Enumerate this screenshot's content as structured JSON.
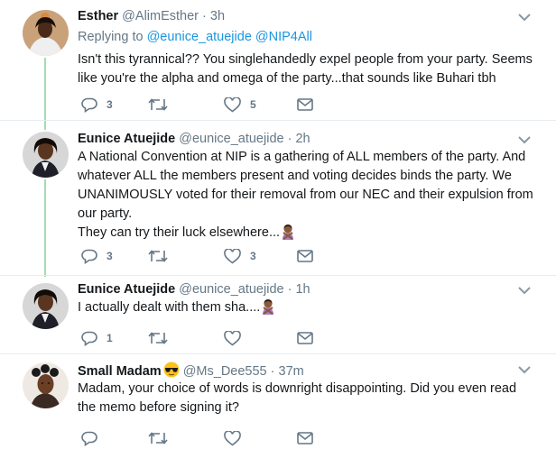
{
  "tweets": [
    {
      "name": "Esther",
      "handle": "@AlimEsther",
      "dot": "·",
      "time": "3h",
      "replying_prefix": "Replying to",
      "replying_users": "@eunice_atuejide @NIP4All",
      "text": [
        "Isn't this tyrannical?? You singlehandedly expel people from your party. Seems like you're the alpha and omega of the party...that sounds like Buhari tbh"
      ],
      "replies": "3",
      "retweets": "",
      "likes": "5"
    },
    {
      "name": "Eunice Atuejide",
      "handle": "@eunice_atuejide",
      "dot": "·",
      "time": "2h",
      "text": [
        "A National Convention at NIP is a gathering of ALL members of the party. And whatever ALL the members present and voting decides binds the party. We UNANIMOUSLY voted for their removal from our NEC and their expulsion from our party.",
        "They can try their luck elsewhere..."
      ],
      "replies": "3",
      "retweets": "",
      "likes": "3"
    },
    {
      "name": "Eunice Atuejide",
      "handle": "@eunice_atuejide",
      "dot": "·",
      "time": "1h",
      "text": [
        "I actually dealt with them sha...."
      ],
      "replies": "1",
      "retweets": "",
      "likes": ""
    },
    {
      "name": "Small Madam",
      "handle": "@Ms_Dee555",
      "dot": "·",
      "time": "37m",
      "text": [
        "Madam, your choice of words is downright disappointing. Did you even read the memo before signing it?"
      ],
      "replies": "",
      "retweets": "",
      "likes": ""
    }
  ],
  "icons": [
    "chevron-down-icon",
    "reply-icon",
    "retweet-icon",
    "like-icon",
    "message-icon",
    "woman-gesturing-no-emoji",
    "sunglasses-emoji"
  ],
  "colors": {
    "link": "#1b95e0",
    "muted": "#657786",
    "thread_line": "#a3ddb0",
    "separator": "#e6ecf0"
  }
}
